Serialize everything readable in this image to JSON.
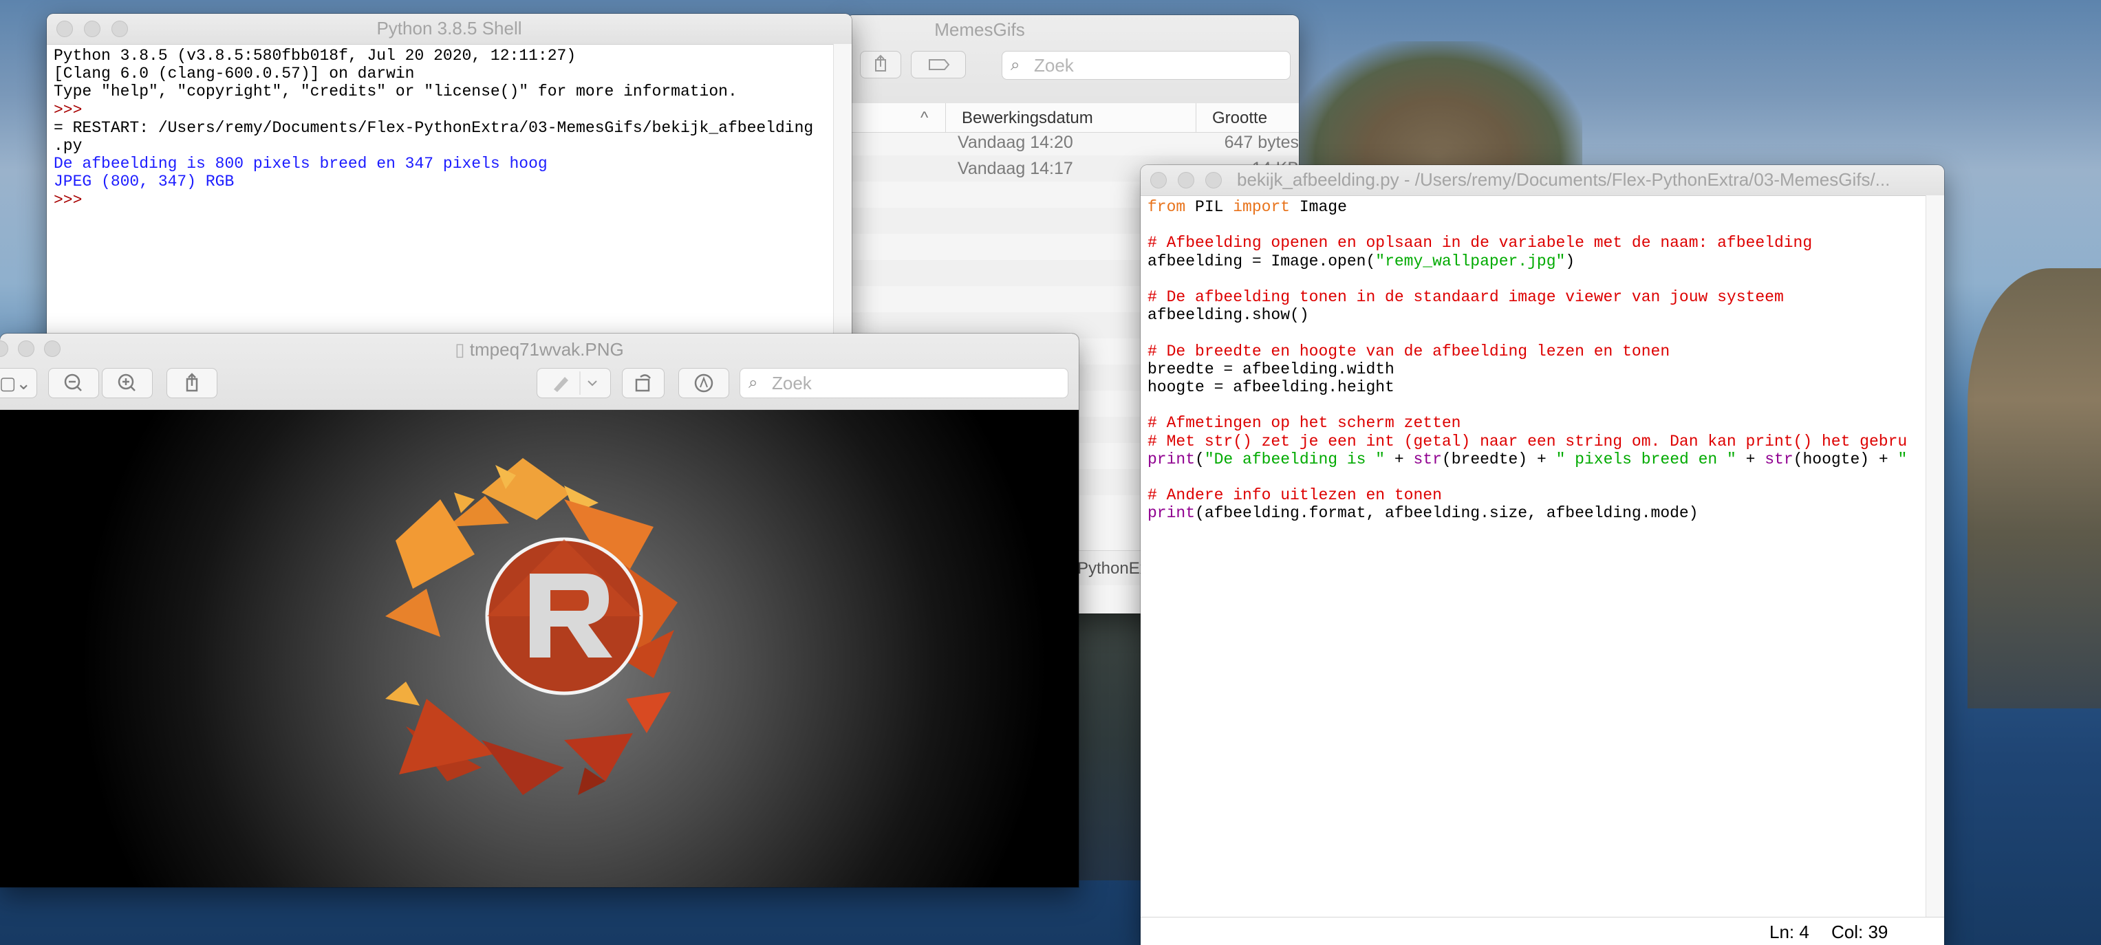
{
  "finder": {
    "title": "MemesGifs",
    "search_placeholder": "Zoek",
    "columns": {
      "date": "Bewerkingsdatum",
      "size": "Grootte"
    },
    "rows": [
      {
        "date": "Vandaag 14:20",
        "size": "647 bytes"
      },
      {
        "date": "Vandaag 14:17",
        "size": "14 KB"
      }
    ],
    "path": "PythonExtra ›"
  },
  "shell": {
    "title": "Python 3.8.5 Shell",
    "lines": {
      "l1": "Python 3.8.5 (v3.8.5:580fbb018f, Jul 20 2020, 12:11:27)",
      "l2": "[Clang 6.0 (clang-600.0.57)] on darwin",
      "l3": "Type \"help\", \"copyright\", \"credits\" or \"license()\" for more information.",
      "l4": ">>> ",
      "l5": "= RESTART: /Users/remy/Documents/Flex-PythonExtra/03-MemesGifs/bekijk_afbeelding",
      "l6": ".py",
      "l7": "De afbeelding is 800 pixels breed en 347 pixels hoog",
      "l8": "JPEG (800, 347) RGB",
      "l9": ">>> "
    }
  },
  "preview": {
    "title": "tmpeq71wvak.PNG",
    "search_placeholder": "Zoek",
    "logo_letter": "R"
  },
  "editor": {
    "title": "bekijk_afbeelding.py - /Users/remy/Documents/Flex-PythonExtra/03-MemesGifs/...",
    "status": {
      "line": "Ln: 4",
      "col": "Col: 39"
    },
    "code": {
      "l1": {
        "a": "from",
        "b": " PIL ",
        "c": "import",
        "d": " Image"
      },
      "l3": "# Afbeelding openen en oplsaan in de variabele met de naam: afbeelding",
      "l4": {
        "a": "afbeelding = Image.open(",
        "b": "\"remy_wallpaper.jpg\"",
        "c": ")"
      },
      "l6": "# De afbeelding tonen in de standaard image viewer van jouw systeem",
      "l7": "afbeelding.show()",
      "l9": "# De breedte en hoogte van de afbeelding lezen en tonen",
      "l10": "breedte = afbeelding.width",
      "l11": "hoogte = afbeelding.height",
      "l13": "# Afmetingen op het scherm zetten",
      "l14": "# Met str() zet je een int (getal) naar een string om. Dan kan print() het gebru",
      "l15": {
        "p1": "print",
        "p2": "(",
        "p3": "\"De afbeelding is \"",
        "p4": " + ",
        "p5": "str",
        "p6": "(breedte) + ",
        "p7": "\" pixels breed en \"",
        "p8": " + ",
        "p9": "str",
        "p10": "(hoogte) + ",
        "p11": "\""
      },
      "l17": "# Andere info uitlezen en tonen",
      "l18": {
        "a": "print",
        "b": "(afbeelding.format, afbeelding.size, afbeelding.mode)"
      }
    }
  }
}
